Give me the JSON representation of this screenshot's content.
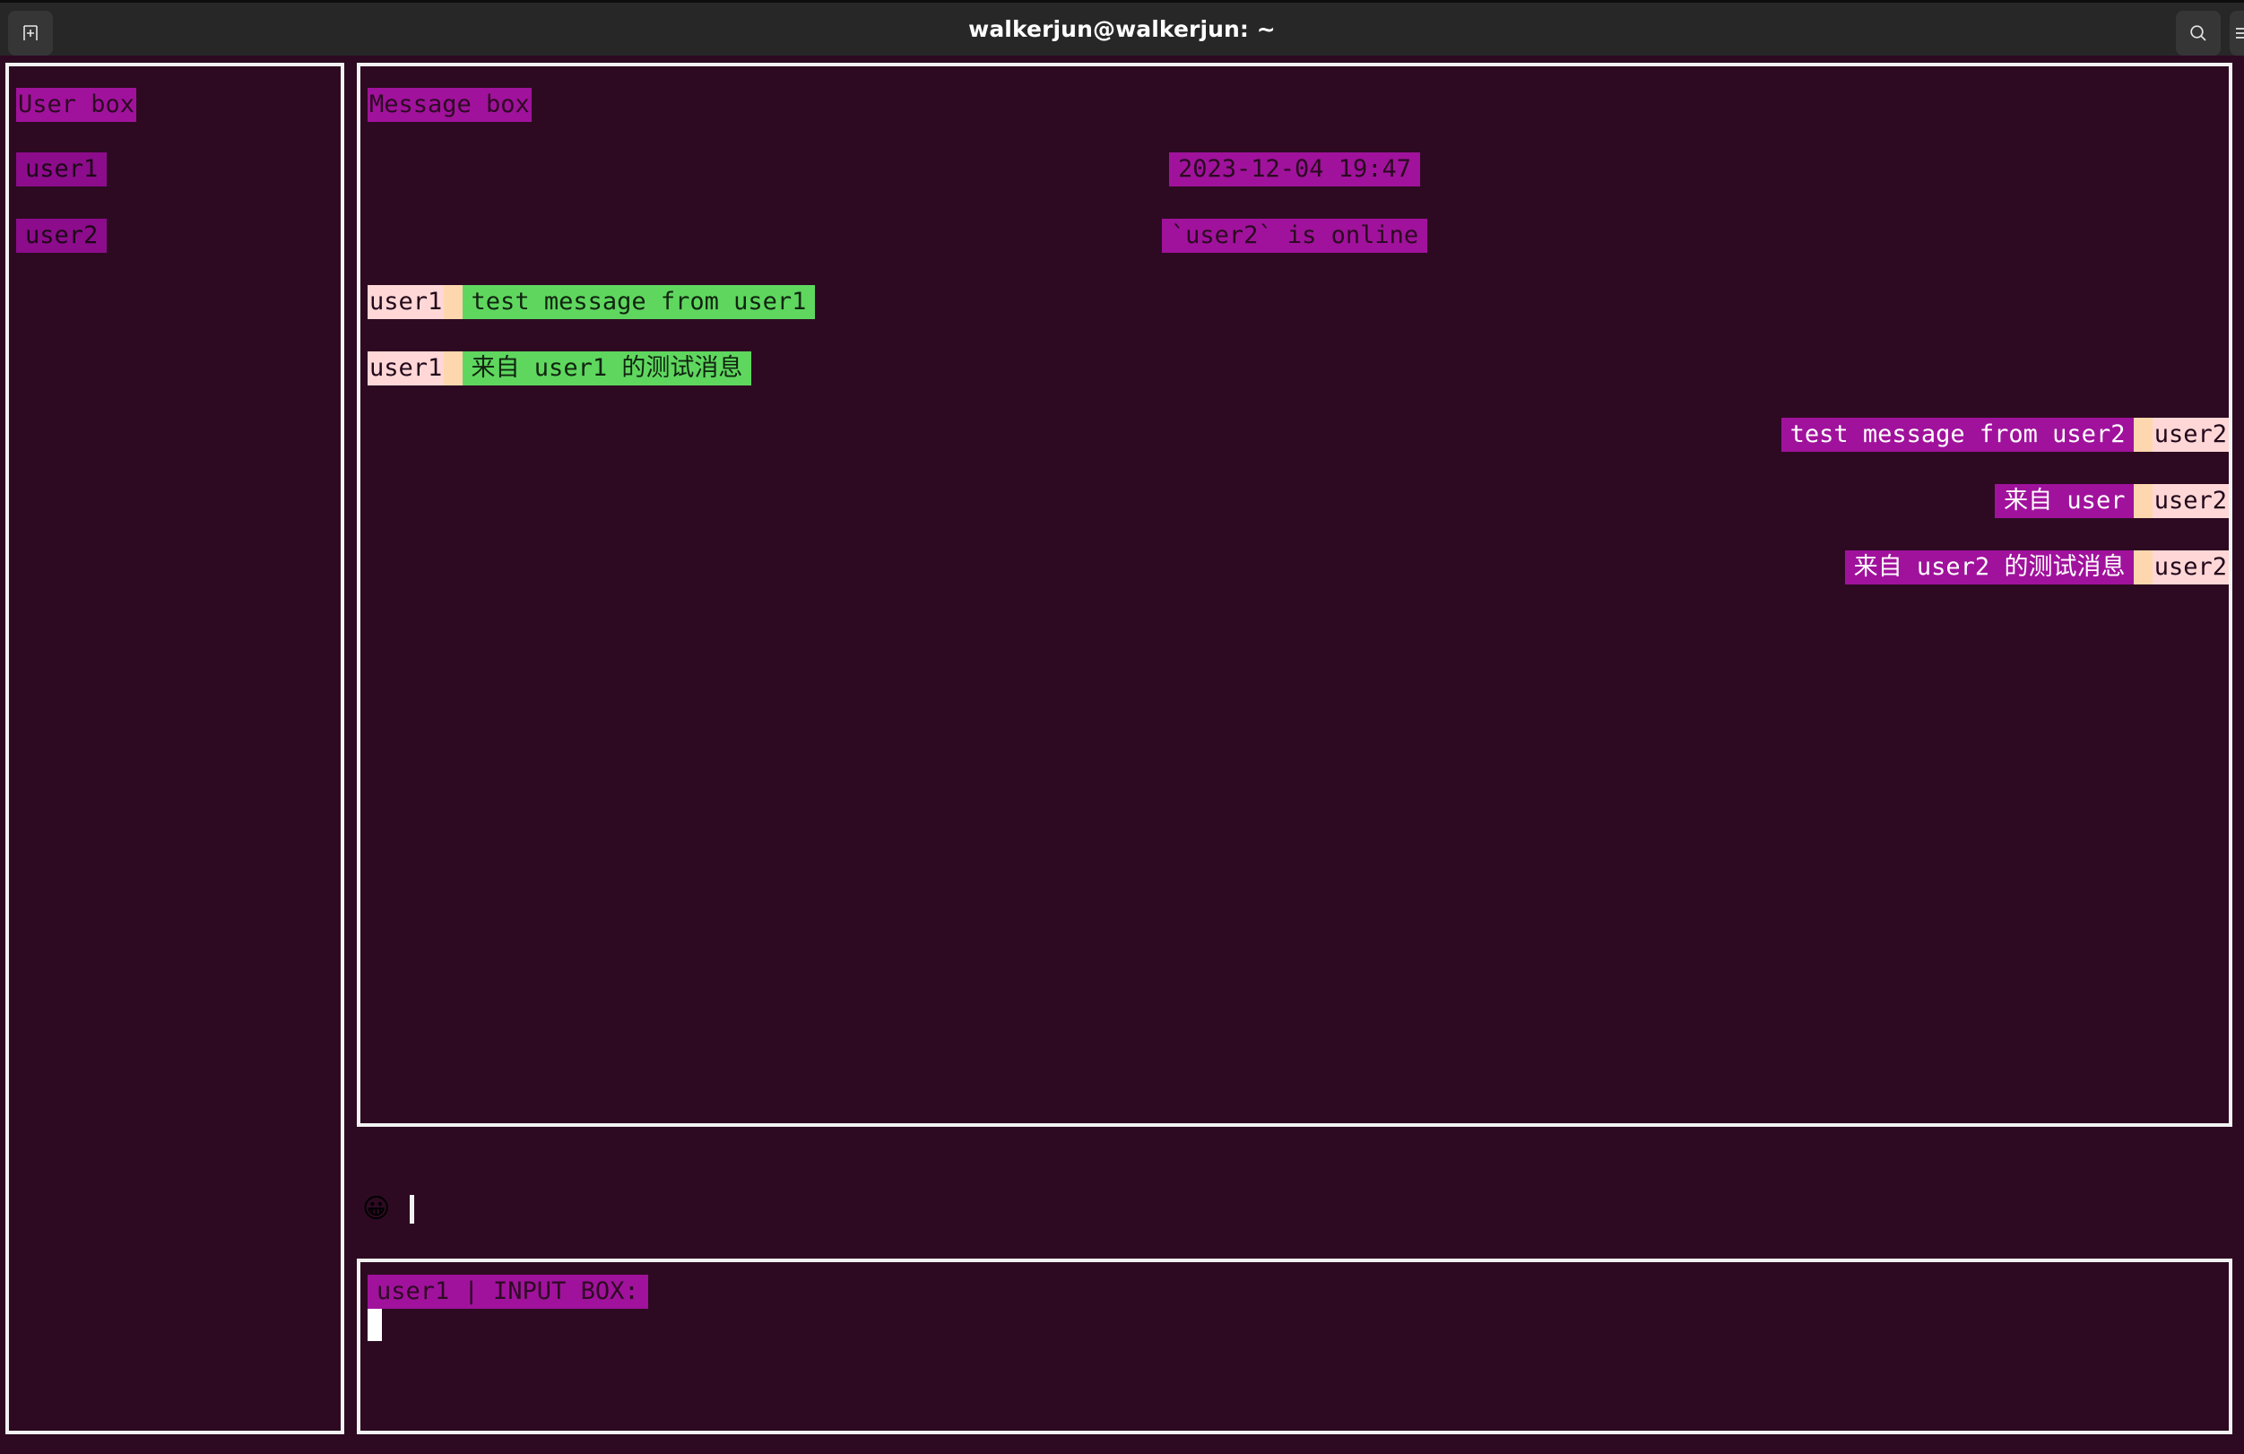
{
  "window": {
    "title": "walkerjun@walkerjun: ~",
    "new_tab_icon": "new-tab-icon",
    "search_icon": "search-icon",
    "menu_icon": "hamburger-menu-icon"
  },
  "colors": {
    "terminal_background": "#2d0a22",
    "titlebar_background": "#272727",
    "border": "#f2f2f2",
    "magenta": "#a0129c",
    "dark_magenta": "#8c0c8c",
    "pink": "#ffd7d7",
    "peach": "#ffd7af",
    "green": "#5fd75f",
    "white": "#ffffff"
  },
  "user_box": {
    "title": "User box",
    "users": [
      {
        "name": "user1"
      },
      {
        "name": "user2"
      }
    ]
  },
  "message_box": {
    "title": "Message box",
    "messages": [
      {
        "kind": "system",
        "align": "center",
        "text": "2023-12-04 19:47"
      },
      {
        "kind": "system",
        "align": "center",
        "text": "`user2` is online"
      },
      {
        "kind": "incoming",
        "align": "left",
        "sender": "user1",
        "text": "test message from user1"
      },
      {
        "kind": "incoming",
        "align": "left",
        "sender": "user1",
        "text": "来自 user1 的测试消息"
      },
      {
        "kind": "outgoing",
        "align": "right",
        "sender": "user2",
        "text": "test message from user2"
      },
      {
        "kind": "outgoing",
        "align": "right",
        "sender": "user2",
        "text": "来自 user"
      },
      {
        "kind": "outgoing",
        "align": "right",
        "sender": "user2",
        "text": "来自 user2 的测试消息"
      }
    ]
  },
  "status_strip": {
    "emoji": "😀",
    "emoji_name": "grinning-face-emoji",
    "cursor": "|"
  },
  "input_box": {
    "label": "user1 | INPUT BOX:",
    "value": ""
  }
}
